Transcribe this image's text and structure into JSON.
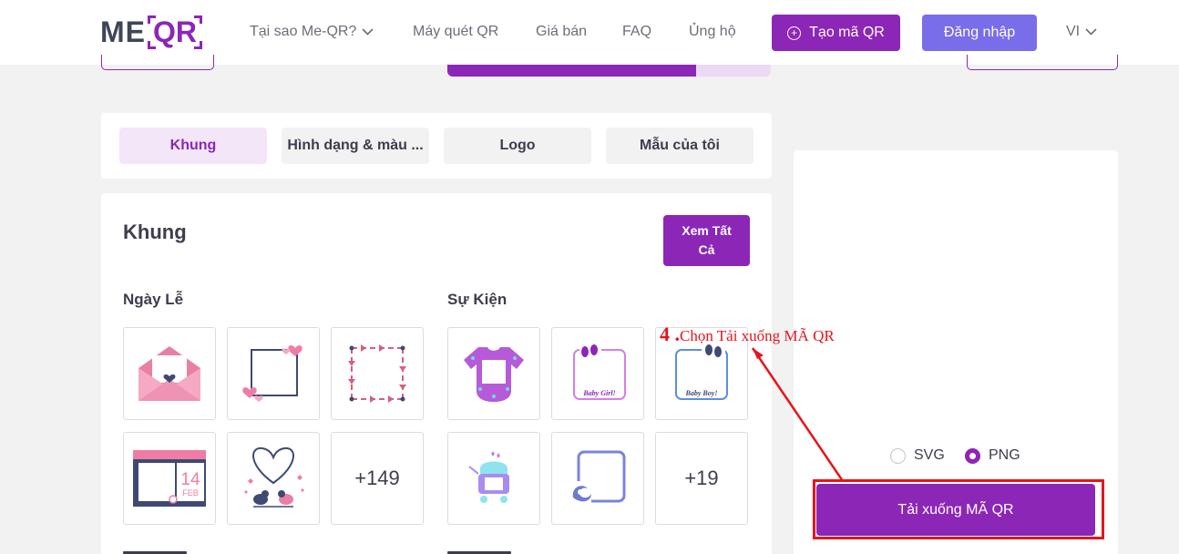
{
  "header": {
    "logo_left": "ME",
    "logo_right": "QR",
    "nav": [
      {
        "label": "Tại sao Me-QR?",
        "has_chevron": true
      },
      {
        "label": "Máy quét QR"
      },
      {
        "label": "Giá bán"
      },
      {
        "label": "FAQ"
      },
      {
        "label": "Ủng hộ"
      }
    ],
    "create_button": "Tạo mã QR",
    "login_button": "Đăng nhập",
    "language": "VI"
  },
  "progress": {
    "value": 0.77
  },
  "tabs": [
    {
      "label": "Khung",
      "active": true
    },
    {
      "label": "Hình dạng & màu ..."
    },
    {
      "label": "Logo"
    },
    {
      "label": "Mẫu của tôi"
    }
  ],
  "frames": {
    "title": "Khung",
    "view_all": "Xem Tất Cả",
    "groups": [
      {
        "title": "Ngày Lễ",
        "more": "+149",
        "items": [
          "envelope-heart-frame",
          "hearts-square-frame",
          "arrows-border-frame",
          "calendar-feb-14-frame",
          "heart-birds-frame"
        ]
      },
      {
        "title": "Sự Kiện",
        "more": "+19",
        "items": [
          "baby-onesie-frame",
          "baby-girl-frame",
          "baby-boy-frame",
          "baby-stroller-frame",
          "stork-frame"
        ]
      }
    ],
    "baby_girl": "Baby Girl!",
    "baby_boy": "Baby Boy!",
    "calendar_day": "14",
    "calendar_month": "FEB"
  },
  "preview": {
    "formats": [
      {
        "label": "SVG",
        "selected": false
      },
      {
        "label": "PNG",
        "selected": true
      }
    ],
    "download_button": "Tải xuống MÃ QR"
  },
  "annotation": {
    "number": "4 .",
    "text": "Chọn Tải xuống MÃ QR",
    "color": "#e8141b"
  },
  "colors": {
    "brand": "#8c26b7",
    "login": "#7a6de9",
    "highlight": "#e8141b"
  }
}
